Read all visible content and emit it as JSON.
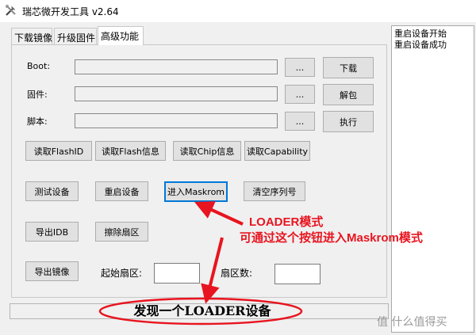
{
  "window": {
    "title": "瑞芯微开发工具 v2.64",
    "app_icon": "tools-icon"
  },
  "tabs": [
    {
      "label": "下载镜像",
      "active": false
    },
    {
      "label": "升级固件",
      "active": false
    },
    {
      "label": "高级功能",
      "active": true
    }
  ],
  "fields": {
    "boot_label": "Boot:",
    "firmware_label": "固件:",
    "script_label": "脚本:",
    "browse_label": "...",
    "download_label": "下载",
    "unpack_label": "解包",
    "execute_label": "执行"
  },
  "actions": {
    "read_flash_id": "读取FlashID",
    "read_flash_info": "读取Flash信息",
    "read_chip_info": "读取Chip信息",
    "read_capability": "读取Capability",
    "test_device": "测试设备",
    "reboot_device": "重启设备",
    "enter_maskrom": "进入Maskrom",
    "clear_serial": "清空序列号",
    "export_idb": "导出IDB",
    "erase_sector": "擦除扇区",
    "export_image": "导出镜像",
    "start_sector_label": "起始扇区:",
    "sector_count_label": "扇区数:"
  },
  "log": [
    "重启设备开始",
    "重启设备成功"
  ],
  "status": {
    "message": "发现一个LOADER设备"
  },
  "annotation": {
    "line1": "LOADER模式",
    "line2": "可通过这个按钮进入Maskrom模式",
    "color": "#e8141f"
  },
  "watermark": "值 什么值得买"
}
